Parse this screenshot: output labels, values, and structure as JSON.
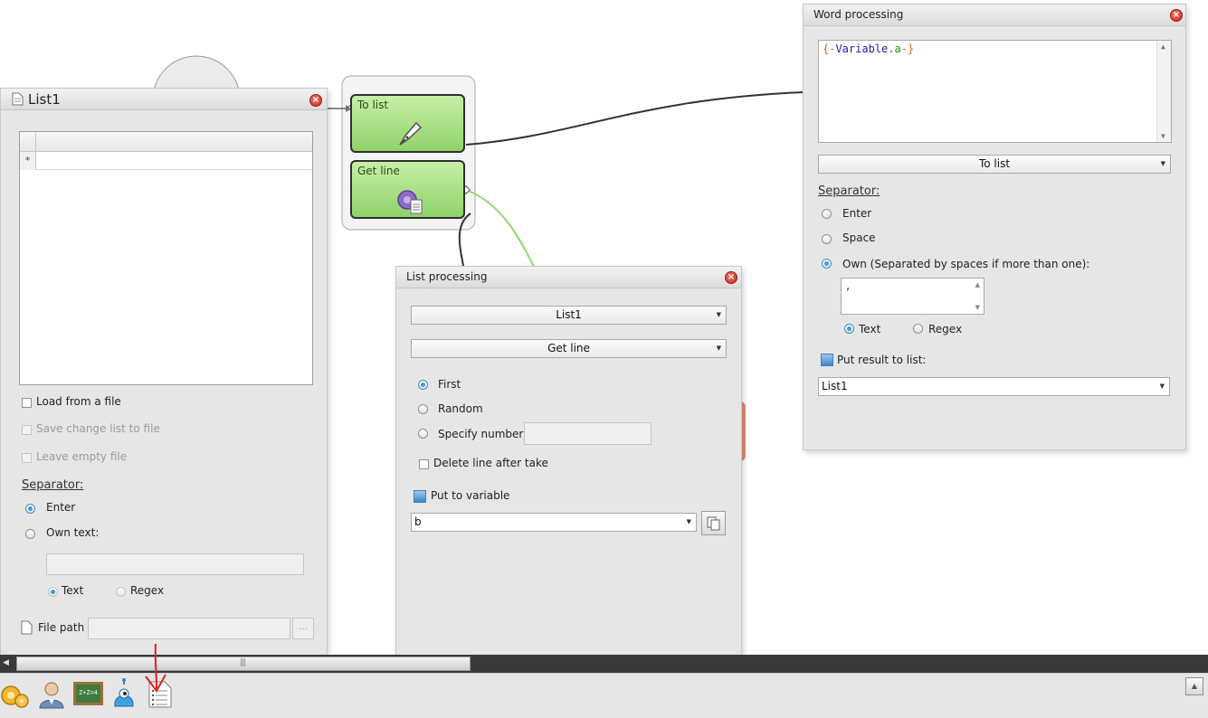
{
  "list1_panel": {
    "title": "List1",
    "load_from_file": "Load from a file",
    "save_change": "Save change list to file",
    "leave_empty": "Leave empty file",
    "separator_heading": "Separator:",
    "sep_enter": "Enter",
    "sep_own": "Own text:",
    "opt_text": "Text",
    "opt_regex": "Regex",
    "file_path_label": "File path",
    "browse_label": "...",
    "grid_new_row_marker": "*"
  },
  "flow": {
    "node_to_list": "To list",
    "node_get_line": "Get line"
  },
  "list_processing": {
    "title": "List processing",
    "list_select": "List1",
    "action_select": "Get line",
    "opt_first": "First",
    "opt_random": "Random",
    "opt_specify": "Specify number",
    "delete_line": "Delete line after take",
    "put_to_variable": "Put to variable",
    "variable_value": "b"
  },
  "word_processing": {
    "title": "Word processing",
    "template_open": "{-",
    "template_var": "Variable",
    "template_dot": ".",
    "template_a": "a",
    "template_close": "-}",
    "mode_select": "To list",
    "separator_heading": "Separator:",
    "sep_enter": "Enter",
    "sep_space": "Space",
    "sep_own": "Own (Separated by spaces if more than one):",
    "own_value": ",",
    "opt_text": "Text",
    "opt_regex": "Regex",
    "put_result": "Put result to list:",
    "result_list": "List1"
  },
  "taskbar": {
    "icons": [
      "gears-icon",
      "user-icon",
      "chalkboard-icon",
      "robot-icon",
      "list-icon"
    ],
    "chalkboard_text": "Z+Z=4"
  },
  "colors": {
    "node_green": "#8fd26a",
    "accent_blue": "#3e9ed8",
    "close_red": "#c8261a",
    "annotation_red": "#e02020"
  }
}
